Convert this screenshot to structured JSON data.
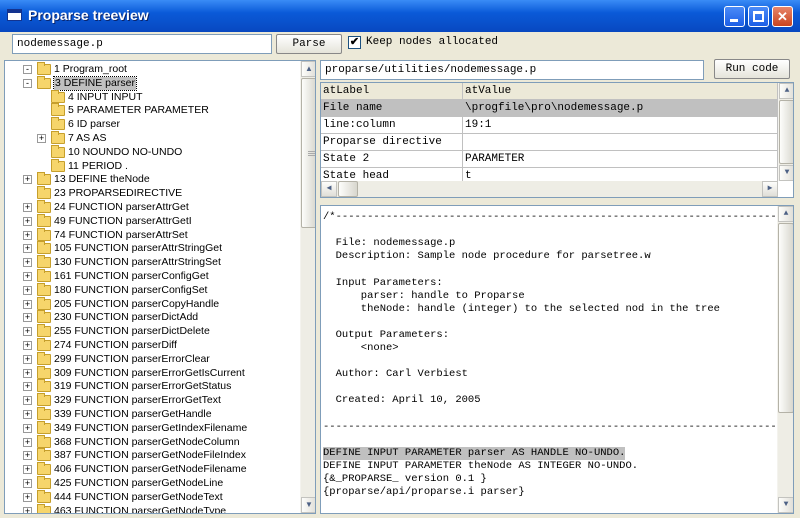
{
  "window": {
    "title": "Proparse treeview"
  },
  "topbar": {
    "file_value": "nodemessage.p",
    "parse_label": "Parse",
    "keep_checked": "✔",
    "keep_label": "Keep nodes allocated"
  },
  "tree": {
    "items": [
      {
        "exp": "-",
        "label": "1 Program_root"
      },
      {
        "exp": "-",
        "label": "3 DEFINE parser"
      },
      {
        "exp": "",
        "label": "4 INPUT INPUT"
      },
      {
        "exp": "",
        "label": "5 PARAMETER PARAMETER"
      },
      {
        "exp": "",
        "label": "6 ID parser"
      },
      {
        "exp": "+",
        "label": "7 AS AS"
      },
      {
        "exp": "",
        "label": "10 NOUNDO NO-UNDO"
      },
      {
        "exp": "",
        "label": "11 PERIOD ."
      },
      {
        "exp": "+",
        "label": "13 DEFINE theNode"
      },
      {
        "exp": "",
        "label": "23 PROPARSEDIRECTIVE"
      },
      {
        "exp": "+",
        "label": "24 FUNCTION parserAttrGet"
      },
      {
        "exp": "+",
        "label": "49 FUNCTION parserAttrGetI"
      },
      {
        "exp": "+",
        "label": "74 FUNCTION parserAttrSet"
      },
      {
        "exp": "+",
        "label": "105 FUNCTION parserAttrStringGet"
      },
      {
        "exp": "+",
        "label": "130 FUNCTION parserAttrStringSet"
      },
      {
        "exp": "+",
        "label": "161 FUNCTION parserConfigGet"
      },
      {
        "exp": "+",
        "label": "180 FUNCTION parserConfigSet"
      },
      {
        "exp": "+",
        "label": "205 FUNCTION parserCopyHandle"
      },
      {
        "exp": "+",
        "label": "230 FUNCTION parserDictAdd"
      },
      {
        "exp": "+",
        "label": "255 FUNCTION parserDictDelete"
      },
      {
        "exp": "+",
        "label": "274 FUNCTION parserDiff"
      },
      {
        "exp": "+",
        "label": "299 FUNCTION parserErrorClear"
      },
      {
        "exp": "+",
        "label": "309 FUNCTION parserErrorGetIsCurrent"
      },
      {
        "exp": "+",
        "label": "319 FUNCTION parserErrorGetStatus"
      },
      {
        "exp": "+",
        "label": "329 FUNCTION parserErrorGetText"
      },
      {
        "exp": "+",
        "label": "339 FUNCTION parserGetHandle"
      },
      {
        "exp": "+",
        "label": "349 FUNCTION parserGetIndexFilename"
      },
      {
        "exp": "+",
        "label": "368 FUNCTION parserGetNodeColumn"
      },
      {
        "exp": "+",
        "label": "387 FUNCTION parserGetNodeFileIndex"
      },
      {
        "exp": "+",
        "label": "406 FUNCTION parserGetNodeFilename"
      },
      {
        "exp": "+",
        "label": "425 FUNCTION parserGetNodeLine"
      },
      {
        "exp": "+",
        "label": "444 FUNCTION parserGetNodeText"
      },
      {
        "exp": "+",
        "label": "463 FUNCTION parserGetNodeType"
      }
    ]
  },
  "right": {
    "path_value": "proparse/utilities/nodemessage.p",
    "run_label": "Run code"
  },
  "attrs": {
    "header": [
      "atLabel",
      "atValue"
    ],
    "rows": [
      [
        "File name",
        "\\progfile\\pro\\nodemessage.p"
      ],
      [
        "line:column",
        "19:1"
      ],
      [
        "Proparse directive",
        ""
      ],
      [
        "State 2",
        "PARAMETER"
      ],
      [
        "State head",
        "t"
      ]
    ]
  },
  "code": {
    "lines": [
      "/*----------------------------------------------------------------------",
      "",
      "  File: nodemessage.p",
      "  Description: Sample node procedure for parsetree.w",
      "",
      "  Input Parameters:",
      "      parser: handle to Proparse",
      "      theNode: handle (integer) to the selected nod in the tree",
      "",
      "  Output Parameters:",
      "      <none>",
      "",
      "  Author: Carl Verbiest",
      "",
      "  Created: April 10, 2005",
      "",
      "------------------------------------------------------------------------",
      "",
      "DEFINE INPUT PARAMETER parser AS HANDLE NO-UNDO.",
      "DEFINE INPUT PARAMETER theNode AS INTEGER NO-UNDO.",
      "{&_PROPARSE_ version 0.1 }",
      "{proparse/api/proparse.i parser}"
    ]
  }
}
